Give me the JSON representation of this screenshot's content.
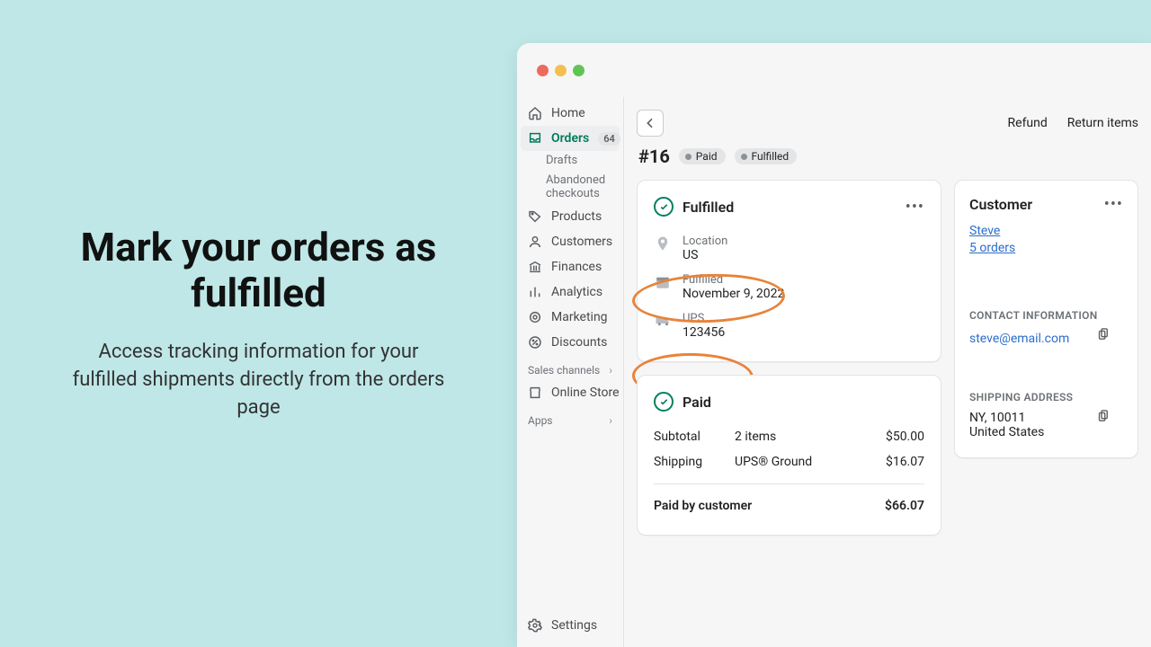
{
  "promo": {
    "headline": "Mark your orders as fulfilled",
    "sub": "Access tracking information for your fulfilled shipments directly from the orders page"
  },
  "sidebar": {
    "home": "Home",
    "orders": "Orders",
    "orders_badge": "64",
    "drafts": "Drafts",
    "abandoned": "Abandoned checkouts",
    "products": "Products",
    "customers": "Customers",
    "finances": "Finances",
    "analytics": "Analytics",
    "marketing": "Marketing",
    "discounts": "Discounts",
    "sales_channels": "Sales channels",
    "online_store": "Online Store",
    "apps": "Apps",
    "settings": "Settings"
  },
  "header": {
    "refund": "Refund",
    "return_items": "Return items",
    "order_id": "#16",
    "status_paid": "Paid",
    "status_fulfilled": "Fulfilled"
  },
  "fulfilled_card": {
    "title": "Fulfilled",
    "location_label": "Location",
    "location_value": "US",
    "fulfilled_label": "Fulfilled",
    "fulfilled_date": "November 9, 2022",
    "carrier": "UPS",
    "tracking": "123456"
  },
  "paid_card": {
    "title": "Paid",
    "subtotal_label": "Subtotal",
    "subtotal_items": "2 items",
    "subtotal_amount": "$50.00",
    "shipping_label": "Shipping",
    "shipping_method": "UPS® Ground",
    "shipping_amount": "$16.07",
    "paid_by_customer": "Paid by customer",
    "paid_amount": "$66.07"
  },
  "customer_card": {
    "title": "Customer",
    "name": "Steve",
    "orders": "5 orders",
    "contact_title": "CONTACT INFORMATION",
    "email": "steve@email.com",
    "shipping_title": "SHIPPING ADDRESS",
    "city_zip": "NY, 10011",
    "country": "United States"
  }
}
